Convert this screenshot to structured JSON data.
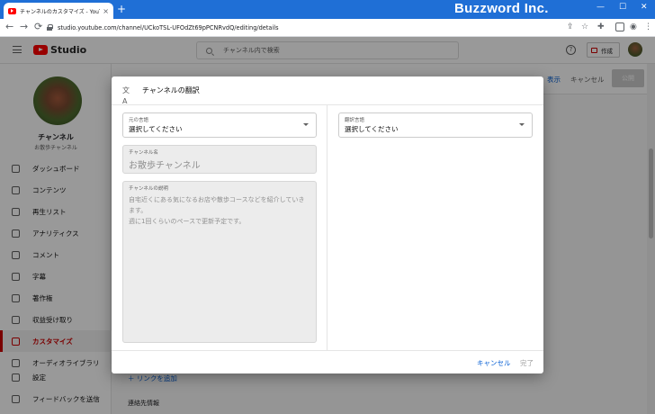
{
  "browser": {
    "tab_title": "チャンネルのカスタマイズ - YouTube Studio",
    "tab_close": "×",
    "new_tab": "+",
    "brand": "Buzzword Inc.",
    "url": "studio.youtube.com/channel/UCkoTSL-UFOdZt69pPCNRvdQ/editing/details",
    "back": "←",
    "forward": "→",
    "reload": "⟳"
  },
  "header": {
    "studio": "Studio",
    "search_placeholder": "チャンネル内で検索",
    "help": "?",
    "create_label": "作成"
  },
  "sidebar": {
    "channel_name": "チャンネル",
    "channel_sub": "お散歩チャンネル",
    "items": [
      {
        "label": "ダッシュボード"
      },
      {
        "label": "コンテンツ"
      },
      {
        "label": "再生リスト"
      },
      {
        "label": "アナリティクス"
      },
      {
        "label": "コメント"
      },
      {
        "label": "字幕"
      },
      {
        "label": "著作権"
      },
      {
        "label": "収益受け取り"
      },
      {
        "label": "カスタマイズ"
      },
      {
        "label": "オーディオライブラリ"
      },
      {
        "label": "設定"
      },
      {
        "label": "フィードバックを送信"
      }
    ]
  },
  "content": {
    "view_link": "表示",
    "cancel": "キャンセル",
    "publish": "公開",
    "add_link": "リンクを追加",
    "contact_label": "連絡先情報"
  },
  "dialog": {
    "title": "チャンネルの翻訳",
    "source_language": {
      "label": "元の言語",
      "value": "選択してください"
    },
    "channel_name": {
      "label": "チャンネル名",
      "value": "お散歩チャンネル"
    },
    "channel_description": {
      "label": "チャンネルの説明",
      "value": "自宅近くにある気になるお店や散歩コースなどを紹介していきます。\n週に1回くらいのペースで更新予定です。"
    },
    "target_language": {
      "label": "翻訳言語",
      "value": "選択してください"
    },
    "cancel": "キャンセル",
    "done": "完了"
  }
}
